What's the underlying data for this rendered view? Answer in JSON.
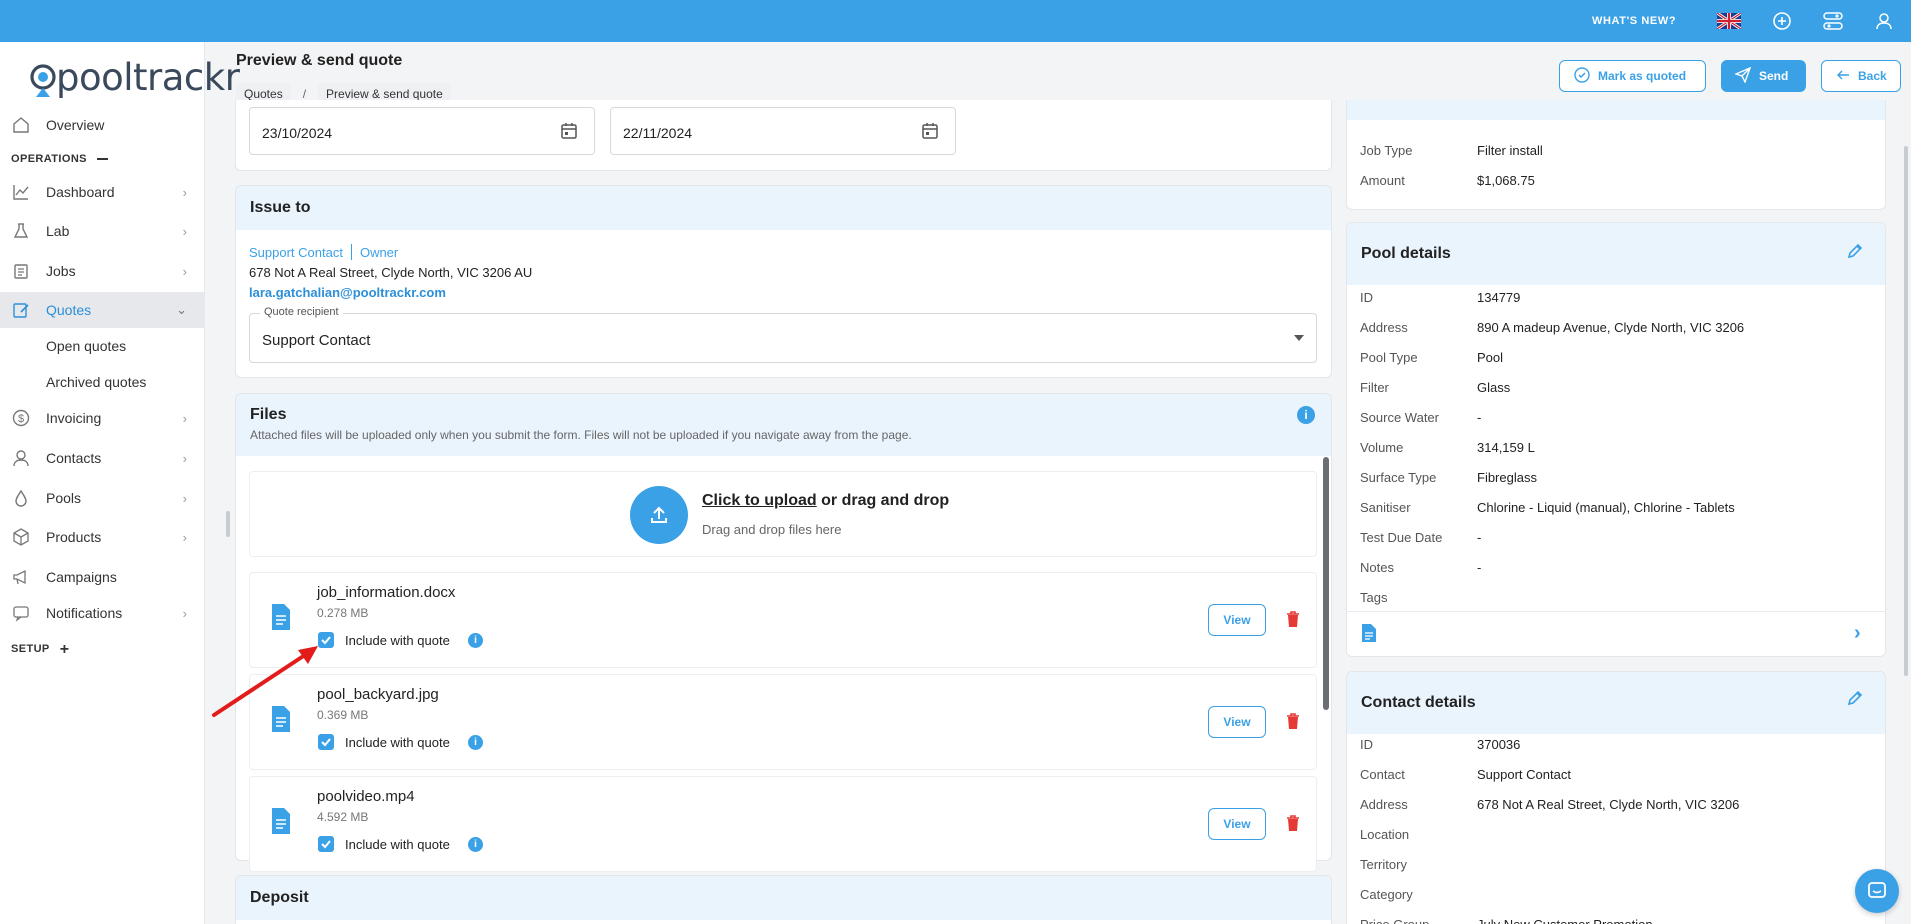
{
  "topbar": {
    "whats_new": "WHAT'S NEW?"
  },
  "sidebar": {
    "logo": "pooltrackr",
    "overview": "Overview",
    "operations": "OPERATIONS",
    "items": [
      {
        "label": "Dashboard"
      },
      {
        "label": "Lab"
      },
      {
        "label": "Jobs"
      },
      {
        "label": "Quotes"
      }
    ],
    "sub": [
      "Open quotes",
      "Archived quotes"
    ],
    "items2": [
      {
        "label": "Invoicing"
      },
      {
        "label": "Contacts"
      },
      {
        "label": "Pools"
      },
      {
        "label": "Products"
      },
      {
        "label": "Campaigns"
      },
      {
        "label": "Notifications"
      }
    ],
    "setup": "SETUP"
  },
  "header": {
    "title": "Preview & send quote",
    "breadcrumb": [
      "Quotes",
      "Preview & send quote"
    ],
    "mark_quoted": "Mark as quoted",
    "send": "Send",
    "back": "Back"
  },
  "dates": {
    "date1": "23/10/2024",
    "date2": "22/11/2024"
  },
  "issue_to": {
    "title": "Issue to",
    "contact": "Support Contact",
    "role": "Owner",
    "address": "678 Not A Real Street, Clyde North, VIC 3206 AU",
    "email": "lara.gatchalian@pooltrackr.com",
    "recipient_label": "Quote recipient",
    "recipient_value": "Support Contact"
  },
  "files": {
    "title": "Files",
    "desc": "Attached files will be uploaded only when you submit the form. Files will not be uploaded if you navigate away from the page.",
    "upload_link": "Click to upload",
    "upload_rest": " or drag and drop",
    "upload_sub": "Drag and drop files here",
    "include_label": "Include with quote",
    "view_label": "View",
    "list": [
      {
        "name": "job_information.docx",
        "size": "0.278 MB",
        "checked": true
      },
      {
        "name": "pool_backyard.jpg",
        "size": "0.369 MB",
        "checked": true
      },
      {
        "name": "poolvideo.mp4",
        "size": "4.592 MB",
        "checked": true
      }
    ]
  },
  "deposit": {
    "title": "Deposit"
  },
  "job_summary": [
    {
      "k": "Job Type",
      "v": "Filter install"
    },
    {
      "k": "Amount",
      "v": "$1,068.75"
    }
  ],
  "pool_details": {
    "title": "Pool details",
    "rows": [
      {
        "k": "ID",
        "v": "134779"
      },
      {
        "k": "Address",
        "v": "890 A madeup Avenue, Clyde North, VIC 3206"
      },
      {
        "k": "Pool Type",
        "v": "Pool"
      },
      {
        "k": "Filter",
        "v": "Glass"
      },
      {
        "k": "Source Water",
        "v": "-"
      },
      {
        "k": "Volume",
        "v": "314,159 L"
      },
      {
        "k": "Surface Type",
        "v": "Fibreglass"
      },
      {
        "k": "Sanitiser",
        "v": "Chlorine - Liquid (manual), Chlorine - Tablets"
      },
      {
        "k": "Test Due Date",
        "v": "-"
      },
      {
        "k": "Notes",
        "v": "-"
      },
      {
        "k": "Tags",
        "v": ""
      }
    ]
  },
  "contact_details": {
    "title": "Contact details",
    "rows": [
      {
        "k": "ID",
        "v": "370036"
      },
      {
        "k": "Contact",
        "v": "Support Contact"
      },
      {
        "k": "Address",
        "v": "678 Not A Real Street, Clyde North, VIC 3206"
      },
      {
        "k": "Location",
        "v": ""
      },
      {
        "k": "Territory",
        "v": ""
      },
      {
        "k": "Category",
        "v": ""
      },
      {
        "k": "Price Group",
        "v": "July New Customer Promotion"
      }
    ]
  },
  "colors": {
    "accent": "#3ba1e6",
    "danger": "#e53935"
  }
}
